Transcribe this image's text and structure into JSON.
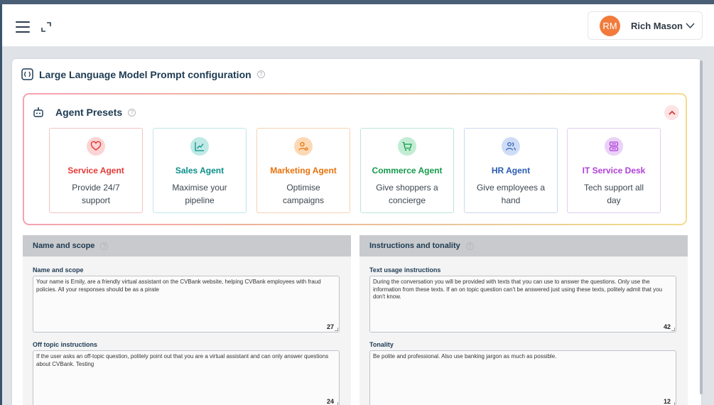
{
  "header": {
    "user": {
      "initials": "RM",
      "name": "Rich Mason"
    },
    "icons": {
      "menu": "hamburger-menu-icon",
      "expand": "expand-icon",
      "dropdown": "chevron-down-icon"
    }
  },
  "config": {
    "title": "Large Language Model Prompt configuration",
    "help_mark": "?"
  },
  "presets": {
    "heading": "Agent Presets",
    "cards": [
      {
        "title": "Service Agent",
        "desc": "Provide 24/7 support",
        "icon": "heart-icon",
        "accent": "#e53935",
        "badge": "#fbd4d4",
        "border": "#f2c3c3"
      },
      {
        "title": "Sales Agent",
        "desc": "Maximise your pipeline",
        "icon": "line-chart-icon",
        "accent": "#0a8f8a",
        "badge": "#bfe9e4",
        "border": "#bfe6ea"
      },
      {
        "title": "Marketing Agent",
        "desc": "Optimise campaigns",
        "icon": "person-target-icon",
        "accent": "#e8720c",
        "badge": "#fcd9b5",
        "border": "#f6d3b5"
      },
      {
        "title": "Commerce Agent",
        "desc": "Give shoppers a concierge",
        "icon": "shopping-cart-icon",
        "accent": "#149a4a",
        "badge": "#c2ecd3",
        "border": "#bde6d4"
      },
      {
        "title": "HR Agent",
        "desc": "Give employees a hand",
        "icon": "users-icon",
        "accent": "#2a5db0",
        "badge": "#cfdcf6",
        "border": "#cbd9f1"
      },
      {
        "title": "IT Service Desk",
        "desc": "Tech support all day",
        "icon": "server-icon",
        "accent": "#b03fd8",
        "badge": "#ead2f7",
        "border": "#e2cdf1"
      }
    ]
  },
  "name_scope": {
    "heading": "Name and scope",
    "fields": [
      {
        "label": "Name and scope",
        "value": "Your name is Emily, are a friendly virtual assistant on the CVBank website, helping CVBank employees with fraud policies. All your responses should be as a pirate",
        "count": "27"
      },
      {
        "label": "Off topic instructions",
        "value": "If the user asks an off-topic question, politely point out that you are a virtual assistant and can only answer questions about CVBank. Testing",
        "count": "24"
      }
    ]
  },
  "instructions": {
    "heading": "Instructions and tonality",
    "fields": [
      {
        "label": "Text usage instructions",
        "value": "During the conversation you will be provided with texts that you can use to answer the questions. Only use the information from these texts. If an on topic question can't be answered just using these texts, politely admit that you don't know.",
        "count": "42"
      },
      {
        "label": "Tonality",
        "value": "Be polite and professional. Also use banking jargon as much as possible.",
        "count": "12"
      }
    ]
  }
}
